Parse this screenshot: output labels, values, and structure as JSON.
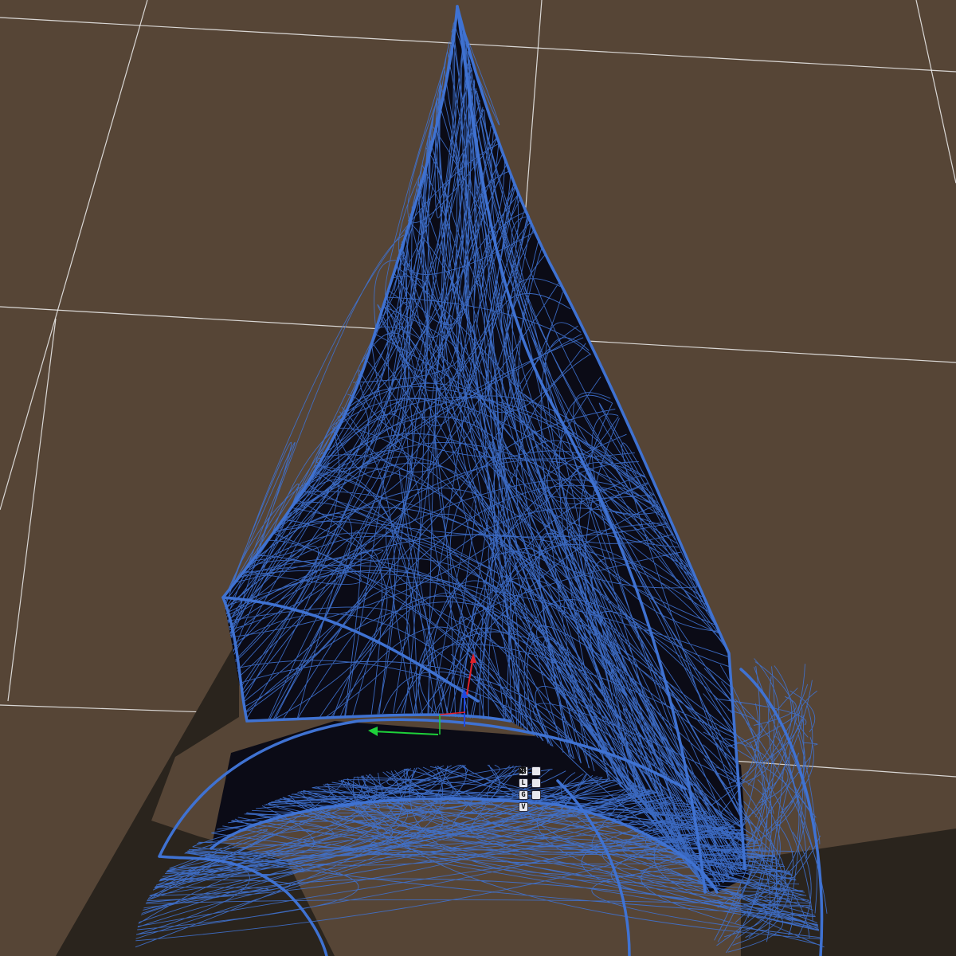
{
  "viewport": {
    "background_color": "#564536",
    "grid_color": "#f2f2f2",
    "shadow_color": "#2a241d",
    "mesh_fill_color": "#0b0b16",
    "wireframe_color": "#3f72d2"
  },
  "transform_gizmo": {
    "x_axis_color": "#e0202a",
    "y_axis_color": "#1ed23a",
    "z_axis_color": "#2048e0"
  },
  "gizmo_panel": {
    "buttons": [
      {
        "label": "P",
        "icon": null
      },
      {
        "label": "",
        "icon": "move-icon"
      },
      {
        "label": "L",
        "icon": null
      },
      {
        "label": "",
        "icon": "rotate-icon"
      },
      {
        "label": "G",
        "icon": null
      },
      {
        "label": "",
        "icon": "scale-icon"
      },
      {
        "label": "V",
        "icon": null
      }
    ]
  }
}
